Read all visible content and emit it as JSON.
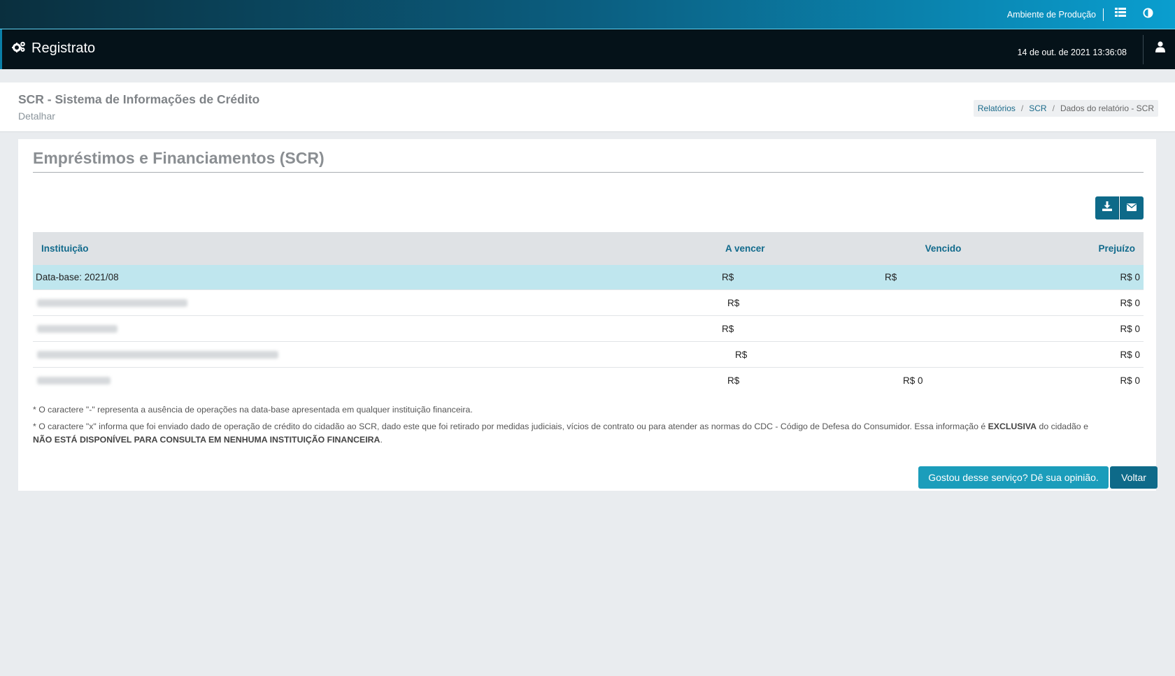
{
  "topbar": {
    "environment_label": "Ambiente de Produção",
    "icons": [
      "list-icon",
      "contrast-icon"
    ]
  },
  "navbar": {
    "brand": "Registrato",
    "brand_icon": "gears-icon",
    "datetime": "14 de out. de 2021 13:36:08",
    "user_icon": "user-icon"
  },
  "header": {
    "title": "SCR - Sistema de Informações de Crédito",
    "subtitle": "Detalhar",
    "breadcrumb": [
      "Relatórios",
      "SCR",
      "Dados do relatório - SCR"
    ]
  },
  "card": {
    "title": "Empréstimos e Financiamentos (SCR)",
    "actions": [
      "download-icon",
      "envelope-icon"
    ]
  },
  "table": {
    "columns": [
      "Instituição",
      "A vencer",
      "Vencido",
      "Prejuízo"
    ],
    "base_row": {
      "label": "Data-base: 2021/08",
      "a_vencer": "R$",
      "vencido": "R$",
      "prejuizo": "R$ 0"
    },
    "rows": [
      {
        "a_vencer": "R$",
        "vencido": "",
        "prejuizo": "R$ 0"
      },
      {
        "a_vencer": "R$",
        "vencido": "",
        "prejuizo": "R$ 0"
      },
      {
        "a_vencer": "R$",
        "vencido": "",
        "prejuizo": "R$ 0"
      },
      {
        "a_vencer": "R$",
        "vencido": "R$ 0",
        "prejuizo": "R$ 0"
      }
    ]
  },
  "notes": {
    "note1": "* O caractere \"-\" representa a ausência de operações na data-base apresentada em qualquer instituição financeira.",
    "note2_part1": "* O caractere \"x\" informa que foi enviado dado de operação de crédito do cidadão ao SCR, dado este que foi retirado por medidas judiciais, vícios de contrato ou para atender as normas do CDC - Código de Defesa do Consumidor. Essa informação é ",
    "note2_bold1": "EXCLUSIVA",
    "note2_part2": " do cidadão e ",
    "note2_bold2": "NÃO ESTÁ DISPONÍVEL PARA CONSULTA EM NENHUMA INSTITUIÇÃO FINANCEIRA",
    "note2_part3": "."
  },
  "buttons": {
    "feedback": "Gostou desse serviço? Dê sua opinião.",
    "back": "Voltar"
  },
  "colors": {
    "primary": "#0e6a89",
    "accent": "#1b9dbb",
    "highlight_row": "#bfe6ee",
    "navbar": "#051219"
  }
}
